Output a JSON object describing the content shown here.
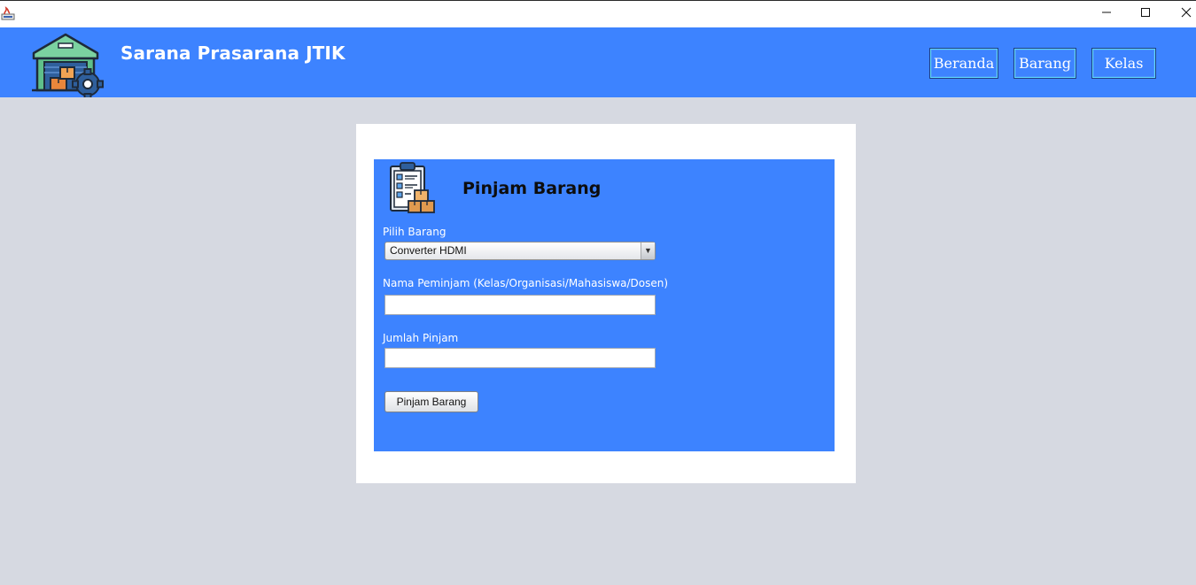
{
  "window": {
    "icon": "java-app-icon",
    "controls": {
      "minimize_icon": "minimize-icon",
      "maximize_icon": "maximize-icon",
      "close_icon": "close-icon"
    }
  },
  "header": {
    "logo_icon": "warehouse-gear-icon",
    "title": "Sarana Prasarana JTIK",
    "nav": [
      {
        "label": "Beranda"
      },
      {
        "label": "Barang"
      },
      {
        "label": "Kelas"
      }
    ]
  },
  "form": {
    "icon": "clipboard-boxes-icon",
    "title": "Pinjam Barang",
    "item_label": "Pilih Barang",
    "item_selected": "Converter HDMI",
    "borrower_label": "Nama Peminjam (Kelas/Organisasi/Mahasiswa/Dosen)",
    "borrower_value": "",
    "quantity_label": "Jumlah Pinjam",
    "quantity_value": "",
    "submit_label": "Pinjam Barang"
  },
  "colors": {
    "header_bg": "#3d83ff",
    "page_bg": "#d6d9e1",
    "card_bg": "#ffffff",
    "nav_border": "#5fd8ff"
  }
}
